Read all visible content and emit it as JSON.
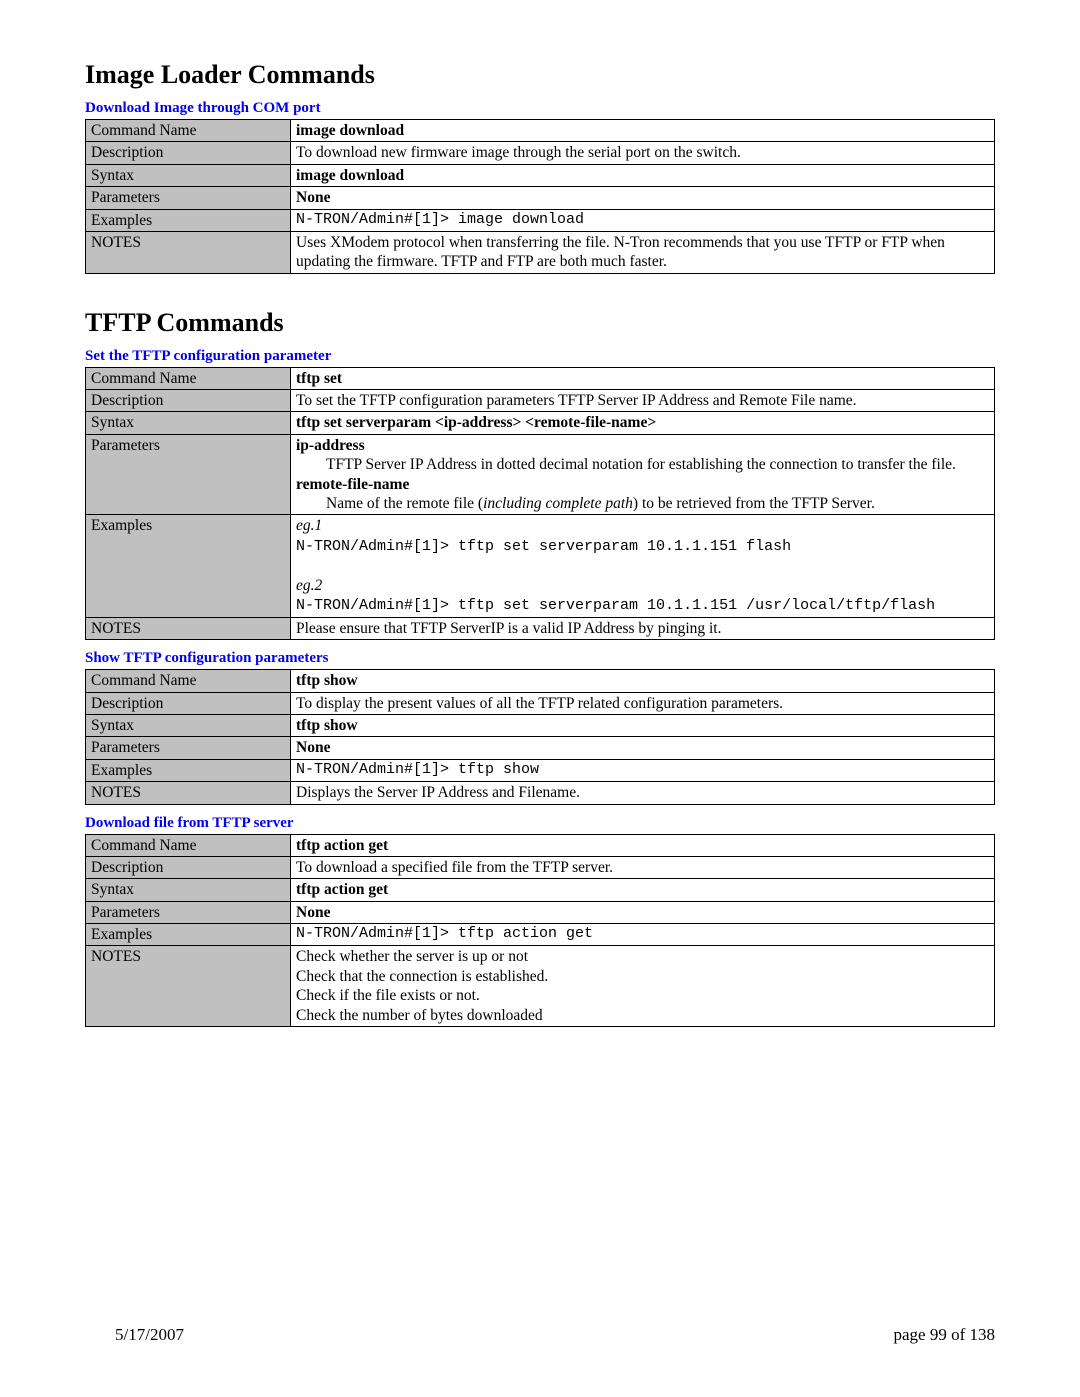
{
  "heading1": "Image Loader Commands",
  "section1": {
    "title": "Download Image through COM port",
    "rows": {
      "commandName": "image download",
      "description": "To download new firmware image through the serial port on the switch.",
      "syntax": "image download",
      "parameters": "None",
      "examples": "N-TRON/Admin#[1]> image download",
      "notes": "Uses XModem protocol when transferring the file.  N-Tron recommends that you use TFTP or FTP when updating the firmware.  TFTP and FTP are both much faster."
    }
  },
  "heading2": "TFTP Commands",
  "section2": {
    "title": "Set the TFTP configuration parameter",
    "rows": {
      "commandName": "tftp set",
      "description": "To set the TFTP configuration parameters TFTP Server IP Address and Remote File name.",
      "syntax": "tftp set serverparam <ip-address> <remote-file-name>",
      "param1Title": "ip-address",
      "param1Desc": "TFTP Server IP Address in dotted decimal notation for establishing the connection to transfer the file.",
      "param2Title": "remote-file-name",
      "param2DescA": "Name of the remote file (",
      "param2DescItalic": "including complete path",
      "param2DescB": ") to be retrieved from the TFTP Server.",
      "eg1Label": "eg.1",
      "eg1": "N-TRON/Admin#[1]> tftp set serverparam 10.1.1.151 flash",
      "eg2Label": "eg.2",
      "eg2": "N-TRON/Admin#[1]> tftp set serverparam 10.1.1.151 /usr/local/tftp/flash",
      "notes": "Please ensure that TFTP ServerIP is a valid IP Address by pinging it."
    }
  },
  "section3": {
    "title": "Show TFTP configuration parameters",
    "rows": {
      "commandName": "tftp show",
      "description": "To display the present values of all the TFTP related configuration parameters.",
      "syntax": "tftp show",
      "parameters": "None",
      "examples": "N-TRON/Admin#[1]> tftp show",
      "notes": "Displays the Server IP Address and Filename."
    }
  },
  "section4": {
    "title": "Download file from TFTP server",
    "rows": {
      "commandName": "tftp action get",
      "description": "To download a specified file from the TFTP server.",
      "syntax": "tftp action get",
      "parameters": "None",
      "examples": "N-TRON/Admin#[1]> tftp action get",
      "notesL1": "Check whether the server is up or not",
      "notesL2": "Check that the connection is established.",
      "notesL3": "Check if the file exists or not.",
      "notesL4": "Check the number of bytes downloaded"
    }
  },
  "labels": {
    "commandName": "Command Name",
    "description": "Description",
    "syntax": "Syntax",
    "parameters": "Parameters",
    "examples": "Examples",
    "notes": "NOTES"
  },
  "footer": {
    "date": "5/17/2007",
    "page": "page 99 of 138"
  }
}
